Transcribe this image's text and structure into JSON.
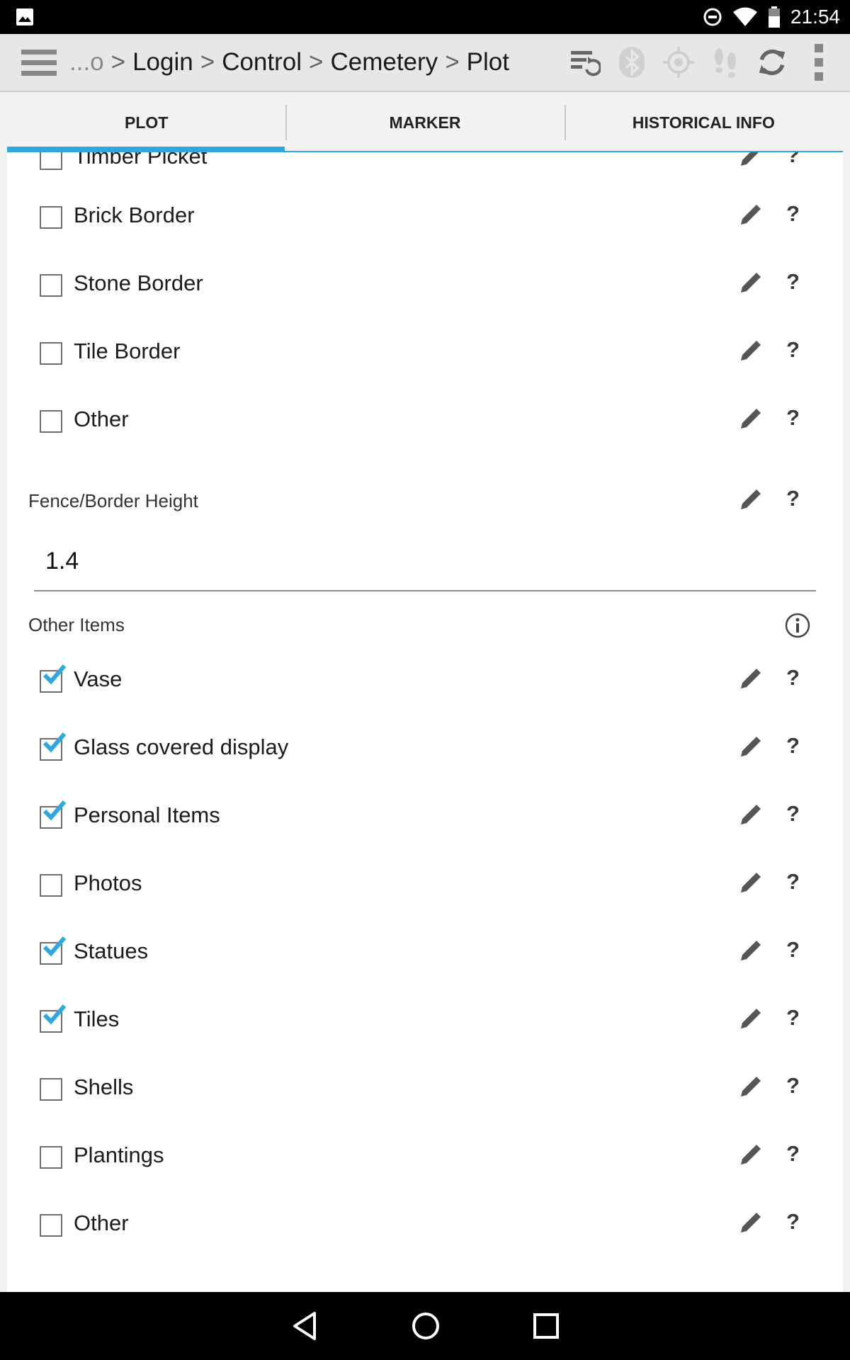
{
  "status_bar": {
    "time": "21:54"
  },
  "breadcrumb": {
    "parts": [
      "...o",
      "Login",
      "Control",
      "Cemetery",
      "Plot"
    ],
    "separator": ">"
  },
  "tabs": [
    {
      "label": "PLOT",
      "selected": true
    },
    {
      "label": "MARKER",
      "selected": false
    },
    {
      "label": "HISTORICAL INFO",
      "selected": false
    }
  ],
  "border_items": [
    {
      "label": "Timber Picket",
      "checked": false
    },
    {
      "label": "Brick Border",
      "checked": false
    },
    {
      "label": "Stone Border",
      "checked": false
    },
    {
      "label": "Tile Border",
      "checked": false
    },
    {
      "label": "Other",
      "checked": false
    }
  ],
  "fence_height": {
    "label": "Fence/Border Height",
    "value": "1.4"
  },
  "other_items": {
    "label": "Other Items",
    "items": [
      {
        "label": "Vase",
        "checked": true
      },
      {
        "label": "Glass covered display",
        "checked": true
      },
      {
        "label": "Personal Items",
        "checked": true
      },
      {
        "label": "Photos",
        "checked": false
      },
      {
        "label": "Statues",
        "checked": true
      },
      {
        "label": "Tiles",
        "checked": true
      },
      {
        "label": "Shells",
        "checked": false
      },
      {
        "label": "Plantings",
        "checked": false
      },
      {
        "label": "Other",
        "checked": false
      }
    ]
  },
  "help_glyph": "?",
  "colors": {
    "accent": "#2fa8e0",
    "check": "#2fa8e0",
    "action_bar": "#e7e7e7"
  },
  "icons": [
    "menu-icon",
    "sync-list-icon",
    "bluetooth-icon",
    "gps-icon",
    "footsteps-icon",
    "refresh-icon",
    "overflow-icon",
    "pencil-icon",
    "help-icon",
    "info-icon"
  ]
}
